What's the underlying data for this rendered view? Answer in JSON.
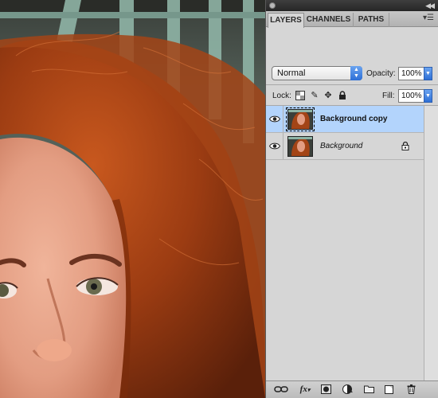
{
  "panel": {
    "tabs": [
      {
        "label": "LAYERS",
        "active": true
      },
      {
        "label": "CHANNELS",
        "active": false
      },
      {
        "label": "PATHS",
        "active": false
      }
    ],
    "menu_icon": "panel-menu-icon",
    "blend_mode": "Normal",
    "opacity_label": "Opacity:",
    "opacity_value": "100%",
    "lock_label": "Lock:",
    "lock_icons": [
      "lock-transparent-pixels-icon",
      "lock-image-pixels-icon",
      "lock-position-icon",
      "lock-all-icon"
    ],
    "fill_label": "Fill:",
    "fill_value": "100%",
    "layers": [
      {
        "name": "Background copy",
        "visible": true,
        "selected": true,
        "locked": false,
        "style": "bold"
      },
      {
        "name": "Background",
        "visible": true,
        "selected": false,
        "locked": true,
        "style": "italic"
      }
    ],
    "bottom_toolbar": [
      "link-layers-icon",
      "layer-style-fx-icon",
      "add-mask-icon",
      "adjustment-layer-icon",
      "new-group-icon",
      "new-layer-icon",
      "trash-icon"
    ],
    "fx_label": "fx",
    "colors": {
      "selected_row": "#b3d4fc",
      "panel_bg": "#d6d6d6",
      "accent_blue": "#2d6fd6"
    }
  }
}
